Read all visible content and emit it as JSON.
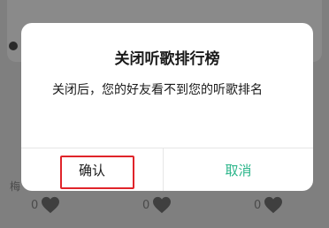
{
  "background": {
    "left_text": "梅",
    "like_counts": [
      "0",
      "0",
      "0"
    ],
    "overlay_color": "#7f7f7f"
  },
  "dialog": {
    "title": "关闭听歌排行榜",
    "message": "关闭后，您的好友看不到您的听歌排名",
    "confirm_label": "确认",
    "cancel_label": "取消",
    "cancel_color": "#2bb58a",
    "highlight_color": "#e0242a"
  }
}
